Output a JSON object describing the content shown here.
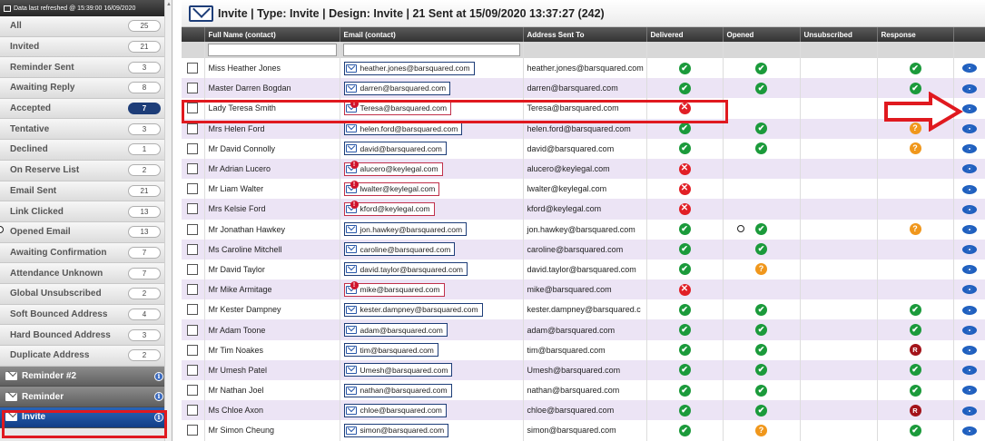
{
  "sidebar": {
    "header": "Data last refreshed @ 15:39:00 16/09/2020",
    "items": [
      {
        "label": "All",
        "count": "25"
      },
      {
        "label": "Invited",
        "count": "21"
      },
      {
        "label": "Reminder Sent",
        "count": "3"
      },
      {
        "label": "Awaiting Reply",
        "count": "8"
      },
      {
        "label": "Accepted",
        "count": "7"
      },
      {
        "label": "Tentative",
        "count": "3"
      },
      {
        "label": "Declined",
        "count": "1"
      },
      {
        "label": "On Reserve List",
        "count": "2"
      },
      {
        "label": "Email Sent",
        "count": "21"
      },
      {
        "label": "Link Clicked",
        "count": "13"
      },
      {
        "label": "Opened Email",
        "count": "13"
      },
      {
        "label": "Awaiting Confirmation",
        "count": "7"
      },
      {
        "label": "Attendance Unknown",
        "count": "7"
      },
      {
        "label": "Global Unsubscribed",
        "count": "2"
      },
      {
        "label": "Soft Bounced Address",
        "count": "4"
      },
      {
        "label": "Hard Bounced Address",
        "count": "3"
      },
      {
        "label": "Duplicate Address",
        "count": "2"
      }
    ],
    "reminders": [
      {
        "label": "Reminder #2"
      },
      {
        "label": "Reminder"
      },
      {
        "label": "Invite"
      }
    ]
  },
  "main": {
    "title": "Invite | Type: Invite | Design: Invite | 21 Sent at 15/09/2020 13:37:27 (242)",
    "columns": [
      "Full Name (contact)",
      "Email (contact)",
      "Address Sent To",
      "Delivered",
      "Opened",
      "Unsubscribed",
      "Response"
    ],
    "rows": [
      {
        "name": "Miss Heather Jones",
        "email": "heather.jones@barsquared.com",
        "sent": "heather.jones@barsquared.com",
        "bad": false,
        "delivered": "ok",
        "opened": "ok",
        "response": "ok"
      },
      {
        "name": "Master Darren Bogdan",
        "email": "darren@barsquared.com",
        "sent": "darren@barsquared.com",
        "bad": false,
        "delivered": "ok",
        "opened": "ok",
        "response": "ok"
      },
      {
        "name": "Lady Teresa Smith",
        "email": "Teresa@barsquared.com",
        "sent": "Teresa@barsquared.com",
        "bad": true,
        "delivered": "x",
        "opened": "",
        "response": ""
      },
      {
        "name": "Mrs Helen Ford",
        "email": "helen.ford@barsquared.com",
        "sent": "helen.ford@barsquared.com",
        "bad": false,
        "delivered": "ok",
        "opened": "ok",
        "response": "q"
      },
      {
        "name": "Mr David Connolly",
        "email": "david@barsquared.com",
        "sent": "david@barsquared.com",
        "bad": false,
        "delivered": "ok",
        "opened": "ok",
        "response": "q"
      },
      {
        "name": "Mr Adrian Lucero",
        "email": "alucero@keylegal.com",
        "sent": "alucero@keylegal.com",
        "bad": true,
        "delivered": "x",
        "opened": "",
        "response": ""
      },
      {
        "name": "Mr Liam Walter",
        "email": "lwalter@keylegal.com",
        "sent": "lwalter@keylegal.com",
        "bad": true,
        "delivered": "x",
        "opened": "",
        "response": ""
      },
      {
        "name": "Mrs Kelsie Ford",
        "email": "kford@keylegal.com",
        "sent": "kford@keylegal.com",
        "bad": true,
        "delivered": "x",
        "opened": "",
        "response": ""
      },
      {
        "name": "Mr Jonathan Hawkey",
        "email": "jon.hawkey@barsquared.com",
        "sent": "jon.hawkey@barsquared.com",
        "bad": false,
        "delivered": "ok",
        "opened": "ok",
        "response": "q"
      },
      {
        "name": "Ms Caroline Mitchell",
        "email": "caroline@barsquared.com",
        "sent": "caroline@barsquared.com",
        "bad": false,
        "delivered": "ok",
        "opened": "ok",
        "response": ""
      },
      {
        "name": "Mr David Taylor",
        "email": "david.taylor@barsquared.com",
        "sent": "david.taylor@barsquared.com",
        "bad": false,
        "delivered": "ok",
        "opened": "q",
        "response": ""
      },
      {
        "name": "Mr Mike Armitage",
        "email": "mike@barsquared.com",
        "sent": "mike@barsquared.com",
        "bad": true,
        "delivered": "x",
        "opened": "",
        "response": ""
      },
      {
        "name": "Mr Kester Dampney",
        "email": "kester.dampney@barsquared.com",
        "sent": "kester.dampney@barsquared.c",
        "bad": false,
        "delivered": "ok",
        "opened": "ok",
        "response": "ok"
      },
      {
        "name": "Mr Adam Toone",
        "email": "adam@barsquared.com",
        "sent": "adam@barsquared.com",
        "bad": false,
        "delivered": "ok",
        "opened": "ok",
        "response": "ok"
      },
      {
        "name": "Mr Tim Noakes",
        "email": "tim@barsquared.com",
        "sent": "tim@barsquared.com",
        "bad": false,
        "delivered": "ok",
        "opened": "ok",
        "response": "r"
      },
      {
        "name": "Mr Umesh Patel",
        "email": "Umesh@barsquared.com",
        "sent": "Umesh@barsquared.com",
        "bad": false,
        "delivered": "ok",
        "opened": "ok",
        "response": "ok"
      },
      {
        "name": "Mr Nathan Joel",
        "email": "nathan@barsquared.com",
        "sent": "nathan@barsquared.com",
        "bad": false,
        "delivered": "ok",
        "opened": "ok",
        "response": "ok"
      },
      {
        "name": "Ms Chloe Axon",
        "email": "chloe@barsquared.com",
        "sent": "chloe@barsquared.com",
        "bad": false,
        "delivered": "ok",
        "opened": "ok",
        "response": "r"
      },
      {
        "name": "Mr Simon Cheung",
        "email": "simon@barsquared.com",
        "sent": "simon@barsquared.com",
        "bad": false,
        "delivered": "ok",
        "opened": "q",
        "response": "ok"
      }
    ],
    "status_glyphs": {
      "ok": "✔",
      "x": "✕",
      "q": "?",
      "r": "R"
    }
  },
  "colors": {
    "accent": "#1d3d78",
    "highlight": "#e0191f",
    "ok": "#1b9a3b",
    "error": "#e11f26",
    "warning": "#f0971c"
  }
}
